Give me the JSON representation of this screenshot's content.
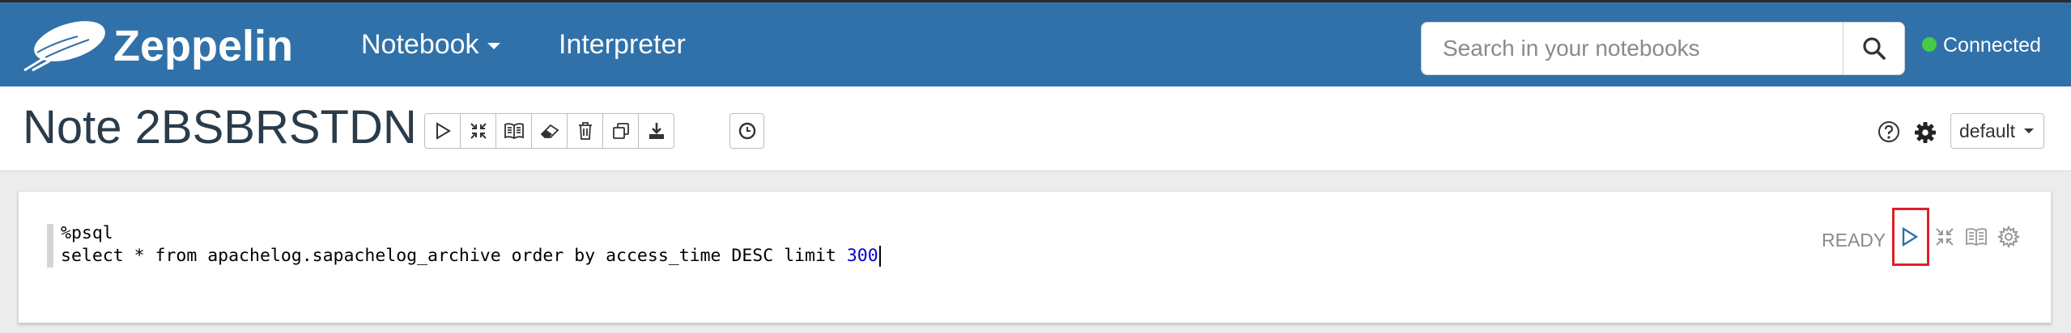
{
  "navbar": {
    "brand": "Zeppelin",
    "notebook_label": "Notebook",
    "interpreter_label": "Interpreter",
    "search_placeholder": "Search in your notebooks",
    "status_label": "Connected",
    "status_color": "#44cc44",
    "background_color": "#3071a9"
  },
  "note": {
    "title": "Note 2BSBRSTDN",
    "toolbar_icons": [
      "run-all-icon",
      "hide-code-icon",
      "hide-output-icon",
      "clear-output-icon",
      "trash-icon",
      "clone-icon",
      "export-icon"
    ],
    "schedule_icon": "clock-icon",
    "help_icon": "question-circle-icon",
    "settings_icon": "gear-icon",
    "default_label": "default"
  },
  "paragraph": {
    "line1": "%psql",
    "line2_text": "select * from apachelog.sapachelog_archive order by access_time DESC limit ",
    "line2_number": "300",
    "status": "READY",
    "icons": [
      "run-icon",
      "hide-code-icon",
      "hide-output-icon",
      "settings-icon"
    ],
    "highlight_color": "#e0202a"
  }
}
